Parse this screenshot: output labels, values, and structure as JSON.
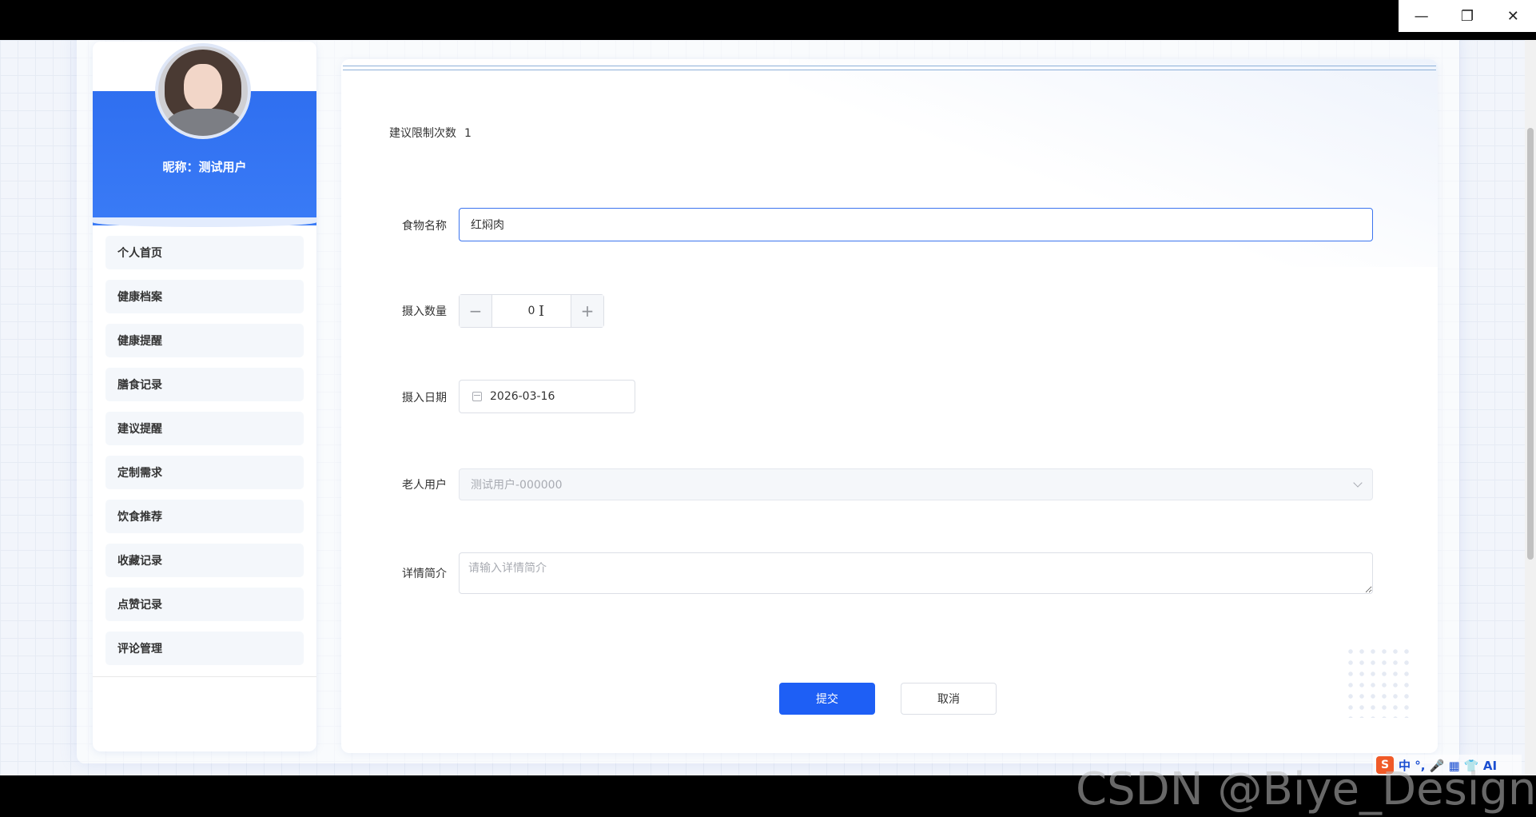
{
  "window": {
    "minimize_glyph": "—",
    "restore_glyph": "❐",
    "close_glyph": "✕"
  },
  "sidebar": {
    "nickname": "昵称：测试用户",
    "items": [
      {
        "label": "个人首页"
      },
      {
        "label": "健康档案"
      },
      {
        "label": "健康提醒"
      },
      {
        "label": "膳食记录"
      },
      {
        "label": "建议提醒"
      },
      {
        "label": "定制需求"
      },
      {
        "label": "饮食推荐"
      },
      {
        "label": "收藏记录"
      },
      {
        "label": "点赞记录"
      },
      {
        "label": "评论管理"
      }
    ]
  },
  "form": {
    "limit_label": "建议限制次数",
    "limit_value": "1",
    "food_name": {
      "label": "食物名称",
      "value": "红焖肉"
    },
    "quantity": {
      "label": "摄入数量",
      "value": "0",
      "minus": "−",
      "plus": "+"
    },
    "date": {
      "label": "摄入日期",
      "value": "2026-03-16"
    },
    "elder_user": {
      "label": "老人用户",
      "value": "测试用户-000000"
    },
    "detail": {
      "label": "详情简介",
      "placeholder": "请输入详情简介"
    },
    "submit_label": "提交",
    "cancel_label": "取消"
  },
  "ime": {
    "logo": "S",
    "items": "中 °, 🎤 ▦ 👕 AI"
  },
  "watermark": "CSDN @Biye_Design",
  "colors": {
    "primary": "#1e5ff5",
    "sidebar_header": "#2f6ff0",
    "input_focus_border": "#3b74ef"
  }
}
